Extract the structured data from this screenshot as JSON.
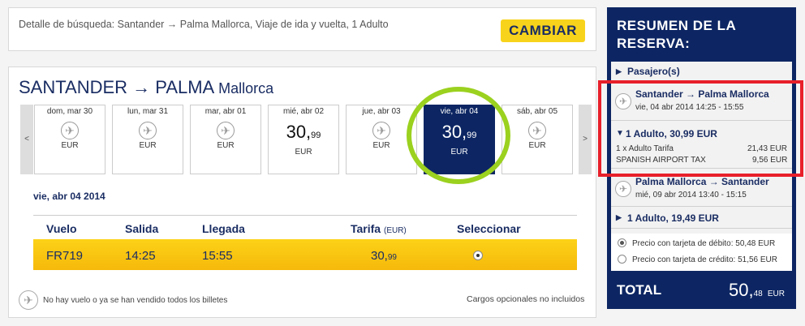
{
  "search": {
    "detail": "Detalle de búsqueda: Santander → Palma Mallorca, Viaje de ida y vuelta, 1 Adulto",
    "change_label": "CAMBIAR"
  },
  "route": {
    "main": "SANTANDER → PALMA",
    "sub": "Mallorca"
  },
  "nav": {
    "prev": "<",
    "next": ">"
  },
  "days": [
    {
      "label": "dom, mar 30",
      "price": "",
      "cents": "",
      "currency": "EUR",
      "available": false
    },
    {
      "label": "lun, mar 31",
      "price": "",
      "cents": "",
      "currency": "EUR",
      "available": false
    },
    {
      "label": "mar, abr 01",
      "price": "",
      "cents": "",
      "currency": "EUR",
      "available": false
    },
    {
      "label": "mié, abr 02",
      "price": "30,",
      "cents": "99",
      "currency": "EUR",
      "available": true
    },
    {
      "label": "jue, abr 03",
      "price": "",
      "cents": "",
      "currency": "EUR",
      "available": false
    },
    {
      "label": "vie, abr 04",
      "price": "30,",
      "cents": "99",
      "currency": "EUR",
      "available": true,
      "selected": true
    },
    {
      "label": "sáb, abr 05",
      "price": "",
      "cents": "",
      "currency": "EUR",
      "available": false
    }
  ],
  "selected_date": "vie, abr 04 2014",
  "table": {
    "headers": {
      "flight": "Vuelo",
      "departure": "Salida",
      "arrival": "Llegada",
      "fare": "Tarifa",
      "fare_unit": "(EUR)",
      "select": "Seleccionar"
    },
    "row": {
      "flight": "FR719",
      "departure": "14:25",
      "arrival": "15:55",
      "price": "30,",
      "cents": "99"
    }
  },
  "legend": {
    "no_flight": "No hay vuelo o ya se han vendido todos los billetes",
    "optional": "Cargos opcionales no incluidos"
  },
  "summary": {
    "title": "RESUMEN DE LA RESERVA:",
    "passengers": "Pasajero(s)",
    "outbound": {
      "route": "Santander → Palma Mallorca",
      "datetime": "vie, 04 abr 2014 14:25 - 15:55",
      "adult_line": "1 Adulto, 30,99 EUR",
      "fare_label": "1 x Adulto Tarifa",
      "fare_value": "21,43 EUR",
      "tax_label": "SPANISH AIRPORT TAX",
      "tax_value": "9,56 EUR"
    },
    "inbound": {
      "route": "Palma Mallorca → Santander",
      "datetime": "mié, 09 abr 2014 13:40 - 15:15",
      "adult_line": "1 Adulto, 19,49 EUR"
    },
    "debit": "Precio con tarjeta de débito: 50,48 EUR",
    "credit": "Precio con tarjeta de crédito: 51,56 EUR",
    "total_label": "TOTAL",
    "total_int": "50,",
    "total_cents": "48",
    "total_currency": "EUR"
  },
  "colors": {
    "brand_navy": "#0d2663",
    "accent_yellow": "#f8d31b",
    "highlight_green": "#9bd11f",
    "annotation_red": "#e8202a"
  }
}
